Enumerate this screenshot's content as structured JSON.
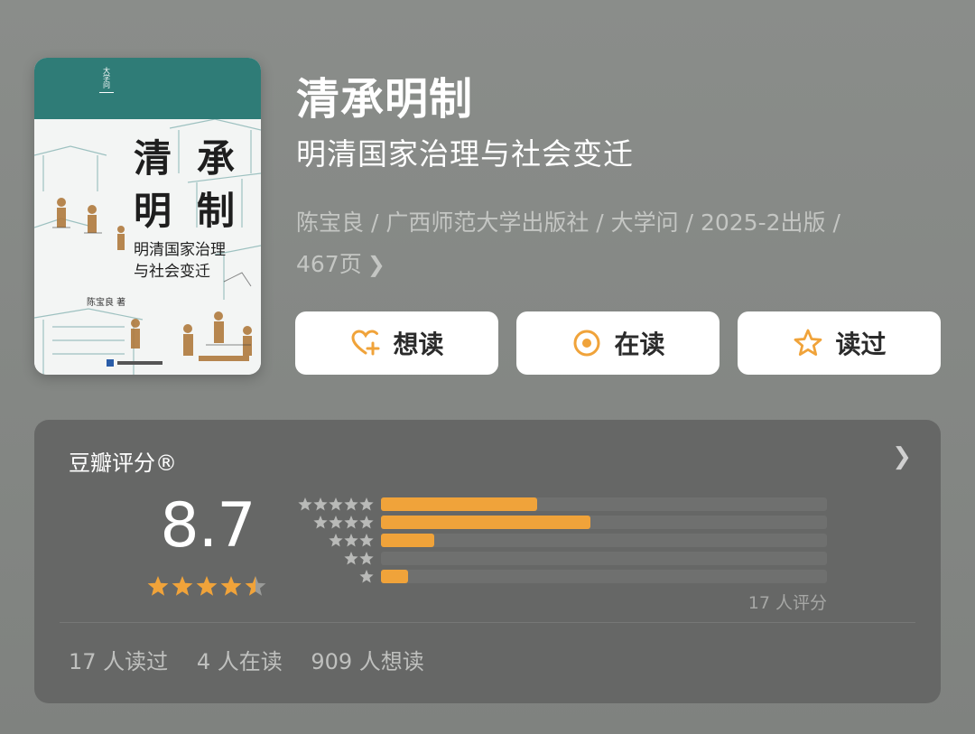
{
  "cover": {
    "publisher_mark": "大学问",
    "title_chars": [
      "清",
      "承",
      "明",
      "制"
    ],
    "subtitle_lines": [
      "明清国家治理",
      "与社会变迁"
    ],
    "author": "陈宝良 著"
  },
  "book": {
    "title": "清承明制",
    "subtitle": "明清国家治理与社会变迁",
    "meta_line1": "陈宝良 / 广西师范大学出版社 / 大学问 / 2025-2出版 /",
    "meta_line2": "467页"
  },
  "actions": [
    {
      "label": "想读",
      "icon": "heart-plus-icon"
    },
    {
      "label": "在读",
      "icon": "target-icon"
    },
    {
      "label": "读过",
      "icon": "star-outline-icon"
    }
  ],
  "rating": {
    "title": "豆瓣评分®",
    "score": "8.7",
    "stars": 4.5,
    "distribution": [
      {
        "stars": 5,
        "fraction": 0.35
      },
      {
        "stars": 4,
        "fraction": 0.47
      },
      {
        "stars": 3,
        "fraction": 0.12
      },
      {
        "stars": 2,
        "fraction": 0.0
      },
      {
        "stars": 1,
        "fraction": 0.06
      }
    ],
    "raters": "17 人评分",
    "stats": [
      "17 人读过",
      "4 人在读",
      "909 人想读"
    ]
  },
  "colors": {
    "accent": "#f0a33a",
    "cover_band": "#2f7c77",
    "card_bg": "#666766"
  }
}
